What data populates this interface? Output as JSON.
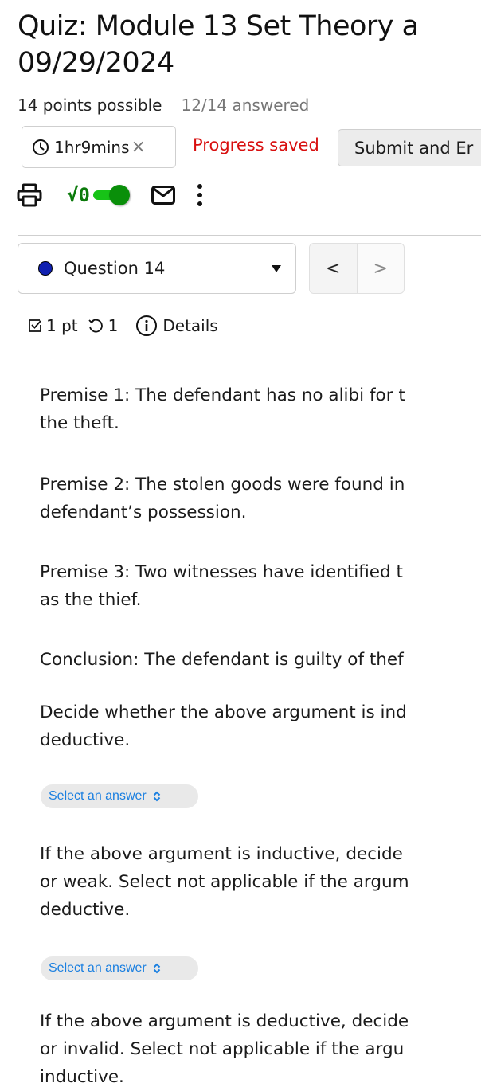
{
  "header": {
    "title_line1": "Quiz: Module 13 Set Theory a",
    "title_line2": "09/29/2024",
    "points_possible": "14 points possible",
    "answered": "12/14 answered"
  },
  "timer": {
    "value": "1hr9mins",
    "close_glyph": "×",
    "icon": "clock-icon"
  },
  "status": {
    "progress_saved": "Progress saved",
    "progress_color": "#d80f0f"
  },
  "actions": {
    "submit_label": "Submit and Er"
  },
  "toolbar": {
    "print_icon": "printer-icon",
    "math_label": "√0",
    "math_toggle_on": true,
    "math_toggle_color": "#0a8f0a",
    "mail_icon": "envelope-icon",
    "more_icon": "kebab-menu-icon"
  },
  "question_nav": {
    "selected": "Question 14",
    "status_dot_color": "#1020b0",
    "prev_glyph": "<",
    "next_glyph": ">"
  },
  "question_info": {
    "points": "1 pt",
    "attempts": "1",
    "details_label": "Details"
  },
  "question": {
    "paragraphs": [
      "Premise 1: The defendant has no alibi for t the theft.",
      "Premise 2: The stolen goods were found in defendant’s possession.",
      "Premise 3: Two witnesses have identified t as the thief.",
      "Conclusion: The defendant is guilty of thef",
      "Decide whether the above argument is ind deductive.",
      "If the above argument is inductive, decide or weak. Select not applicable if the argum deductive.",
      "If the above argument is deductive, decide or invalid. Select not applicable if the argu inductive."
    ],
    "lines": {
      "p1a": "Premise 1: The defendant has no alibi for t",
      "p1b": "the theft.",
      "p2a": "Premise 2: The stolen goods were found in",
      "p2b": "defendant’s possession.",
      "p3a": "Premise 3: Two witnesses have identified t",
      "p3b": "as the thief.",
      "c1": "Conclusion: The defendant is guilty of thef",
      "d1a": "Decide whether the above argument is ind",
      "d1b": "deductive.",
      "i1a": "If the above argument is inductive, decide",
      "i1b": "or weak. Select not applicable if the argum",
      "i1c": "deductive.",
      "e1a": "If the above argument is deductive, decide",
      "e1b": "or invalid. Select not applicable if the argu",
      "e1c": "inductive."
    },
    "answer_selects": [
      {
        "placeholder": "Select an answer",
        "value": ""
      },
      {
        "placeholder": "Select an answer",
        "value": ""
      }
    ],
    "select_text_color": "#1a7fe0"
  }
}
